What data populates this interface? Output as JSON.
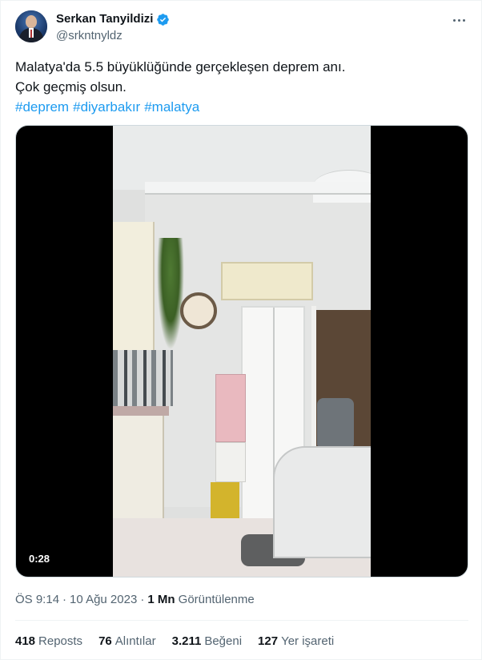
{
  "author": {
    "display_name": "Serkan Tanyildizi",
    "handle": "@srkntnyldz",
    "verified": true
  },
  "tweet": {
    "text_line1": "Malatya'da 5.5 büyüklüğünde gerçekleşen deprem anı.",
    "text_line2": "Çok geçmiş olsun.",
    "hashtags": [
      "#deprem",
      "#diyarbakır",
      "#malatya"
    ]
  },
  "media": {
    "type": "video",
    "duration": "0:28"
  },
  "meta": {
    "time": "ÖS 9:14",
    "date": "10 Ağu 2023",
    "views_count": "1 Mn",
    "views_label": "Görüntülenme"
  },
  "stats": {
    "reposts_count": "418",
    "reposts_label": "Reposts",
    "quotes_count": "76",
    "quotes_label": "Alıntılar",
    "likes_count": "3.211",
    "likes_label": "Beğeni",
    "bookmarks_count": "127",
    "bookmarks_label": "Yer işareti"
  },
  "colors": {
    "link": "#1d9bf0",
    "secondary_text": "#536471",
    "primary_text": "#0f1419"
  }
}
